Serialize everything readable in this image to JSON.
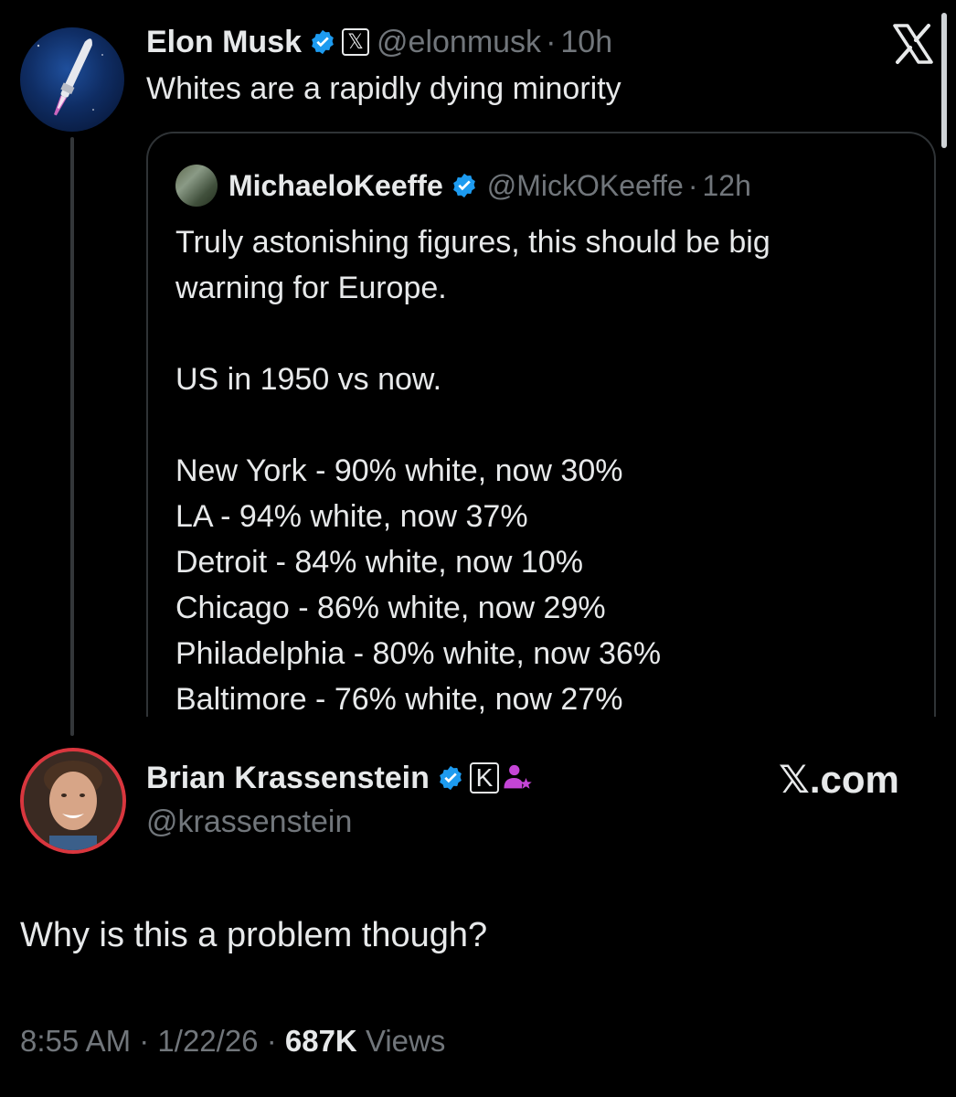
{
  "parent_tweet": {
    "author_name": "Elon Musk",
    "handle": "@elonmusk",
    "separator": "·",
    "time": "10h",
    "text": "Whites are a rapidly dying minority",
    "affiliate_badge_letter": "𝕏"
  },
  "quoted_tweet": {
    "author_name": "MichaeloKeeffe",
    "handle": "@MickOKeeffe",
    "separator": "·",
    "time": "12h",
    "lines": [
      "Truly astonishing figures, this should be big",
      "warning for Europe.",
      "",
      "US in 1950 vs now.",
      "",
      "New York - 90% white, now 30%",
      "LA - 94% white, now 37%",
      "Detroit - 84% white, now 10%",
      "Chicago - 86% white, now 29%",
      "Philadelphia - 80% white, now 36%",
      "Baltimore - 76% white, now 27%"
    ]
  },
  "reply": {
    "author_name": "Brian Krassenstein",
    "handle": "@krassenstein",
    "affiliate_badge_letter": "K",
    "site_label": "𝕏.com",
    "text": "Why is this a problem though?",
    "timestamp": "8:55 AM",
    "separator": "·",
    "date": "1/22/26",
    "views_count": "687K",
    "views_label": "Views"
  },
  "top_right_logo": "𝕏",
  "colors": {
    "background": "#000000",
    "text_primary": "#e7e9ea",
    "text_secondary": "#71767b",
    "verified_blue": "#1d9bf0",
    "border": "#2f3336",
    "avatar_ring_red": "#d9363e",
    "purple_icon": "#c445d6"
  }
}
